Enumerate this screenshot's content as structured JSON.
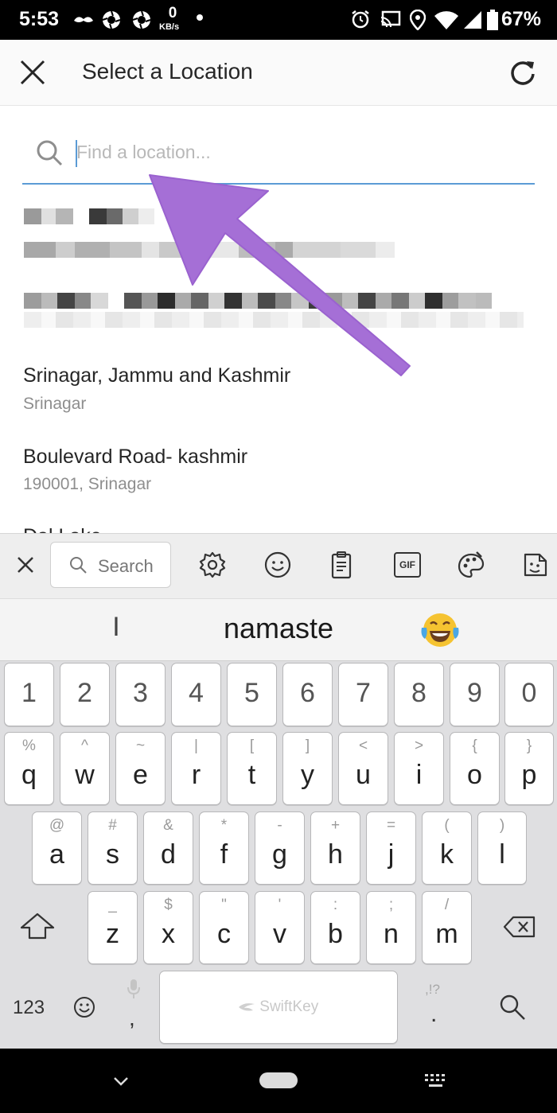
{
  "status_bar": {
    "time": "5:53",
    "net_speed": "0",
    "net_unit": "KB/s",
    "battery": "67%"
  },
  "app_bar": {
    "title": "Select a Location"
  },
  "search": {
    "placeholder": "Find a location..."
  },
  "results": [
    {
      "title": "Srinagar, Jammu and Kashmir",
      "subtitle": "Srinagar"
    },
    {
      "title": "Boulevard Road- kashmir",
      "subtitle": "190001, Srinagar"
    },
    {
      "title": "Dal Lake"
    }
  ],
  "keyboard": {
    "search_label": "Search",
    "gif_label": "GIF",
    "suggestions": [
      "I",
      "namaste",
      "😂"
    ],
    "number_row": [
      "1",
      "2",
      "3",
      "4",
      "5",
      "6",
      "7",
      "8",
      "9",
      "0"
    ],
    "row1": [
      {
        "main": "q",
        "hint": "%"
      },
      {
        "main": "w",
        "hint": "^"
      },
      {
        "main": "e",
        "hint": "~"
      },
      {
        "main": "r",
        "hint": "|"
      },
      {
        "main": "t",
        "hint": "["
      },
      {
        "main": "y",
        "hint": "]"
      },
      {
        "main": "u",
        "hint": "<"
      },
      {
        "main": "i",
        "hint": ">"
      },
      {
        "main": "o",
        "hint": "{"
      },
      {
        "main": "p",
        "hint": "}"
      }
    ],
    "row2": [
      {
        "main": "a",
        "hint": "@"
      },
      {
        "main": "s",
        "hint": "#"
      },
      {
        "main": "d",
        "hint": "&"
      },
      {
        "main": "f",
        "hint": "*"
      },
      {
        "main": "g",
        "hint": "-"
      },
      {
        "main": "h",
        "hint": "+"
      },
      {
        "main": "j",
        "hint": "="
      },
      {
        "main": "k",
        "hint": "("
      },
      {
        "main": "l",
        "hint": ")"
      }
    ],
    "row3": [
      {
        "main": "z",
        "hint": "_"
      },
      {
        "main": "x",
        "hint": "$"
      },
      {
        "main": "c",
        "hint": "\""
      },
      {
        "main": "v",
        "hint": "'"
      },
      {
        "main": "b",
        "hint": ":"
      },
      {
        "main": "n",
        "hint": ";"
      },
      {
        "main": "m",
        "hint": "/"
      }
    ],
    "numbers_key": "123",
    "comma": ",",
    "period": ".",
    "period_hint": ",!?",
    "space_brand": "SwiftKey"
  },
  "colors": {
    "accent": "#5b9bd5",
    "arrow": "#a56fd6"
  }
}
